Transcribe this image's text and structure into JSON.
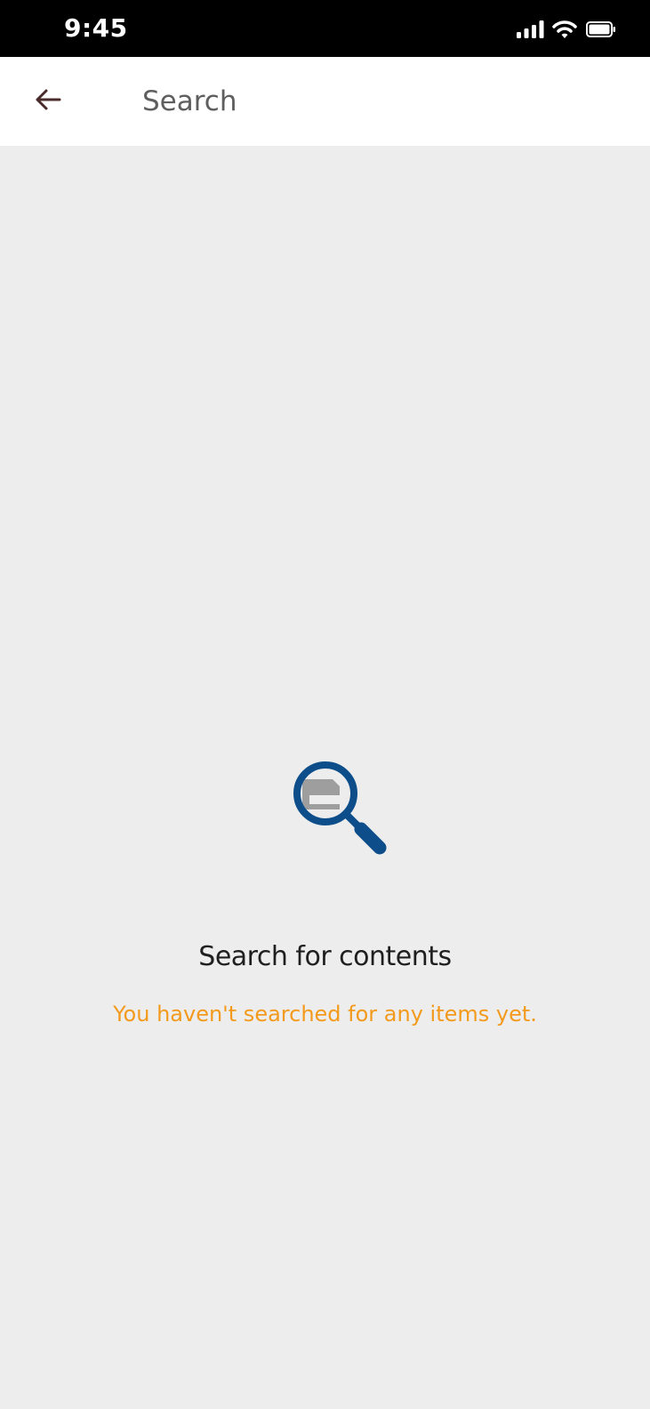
{
  "status_bar": {
    "time": "9:45",
    "icons": [
      "signal-icon",
      "wifi-icon",
      "battery-icon"
    ]
  },
  "header": {
    "back_icon": "back-arrow-icon",
    "search_placeholder": "Search",
    "search_value": ""
  },
  "empty_state": {
    "icon": "magnifier-document-icon",
    "title": "Search for contents",
    "message": "You haven't searched for any items yet."
  },
  "colors": {
    "status_bar_bg": "#000000",
    "header_bg": "#ffffff",
    "page_bg": "#ededed",
    "back_arrow": "#4a2b2b",
    "magnifier": "#0d4e8a",
    "document": "#9e9e9e",
    "title": "#1f1f1f",
    "message": "#f39a1c"
  }
}
